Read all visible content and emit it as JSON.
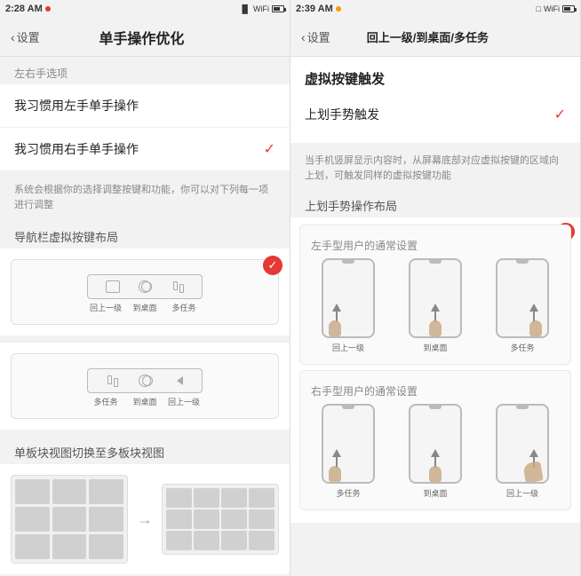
{
  "left_panel": {
    "status_bar": {
      "time": "2:28 AM",
      "dot": "red"
    },
    "nav": {
      "back_label": "设置",
      "title": "单手操作优化"
    },
    "handedness_section_label": "左右手选项",
    "options": [
      {
        "text": "我习惯用左手单手操作",
        "selected": false
      },
      {
        "text": "我习惯用右手单手操作",
        "selected": true
      }
    ],
    "desc": "系统会根据你的选择调整按键和功能，你可以对下列每一项进行调整",
    "nav_layout_label": "导航栏虚拟按键布局",
    "layout1": {
      "labels": [
        "回上一级",
        "到桌面",
        "多任务"
      ]
    },
    "layout2": {
      "labels": [
        "多任务",
        "到桌面",
        "回上一级"
      ]
    },
    "bottom_label": "单板块视图切换至多板块视图"
  },
  "right_panel": {
    "status_bar": {
      "time": "2:39 AM",
      "dot": "orange"
    },
    "nav": {
      "back_label": "设置",
      "title": "回上一级/到桌面/多任务"
    },
    "virtual_btn_title": "虚拟按键触发",
    "virtual_btn_options": [
      {
        "text": "上划手势触发",
        "selected": true
      }
    ],
    "gesture_desc": "当手机竖屏显示内容时，从屏幕底部对应虚拟按键的区域向上划，可触发同样的虚拟按键功能",
    "gesture_layout_label": "上划手势操作布局",
    "left_hand_label": "左手型用户的通常设置",
    "left_hand_gestures": [
      {
        "label": "回上一级"
      },
      {
        "label": "到桌面"
      },
      {
        "label": "多任务"
      }
    ],
    "right_hand_label": "右手型用户的通常设置",
    "right_hand_gestures": [
      {
        "label": "多任务"
      },
      {
        "label": "到桌面"
      },
      {
        "label": "回上一级"
      }
    ]
  },
  "icons": {
    "check": "✓",
    "chevron_left": "‹",
    "arrow_right": "→"
  }
}
